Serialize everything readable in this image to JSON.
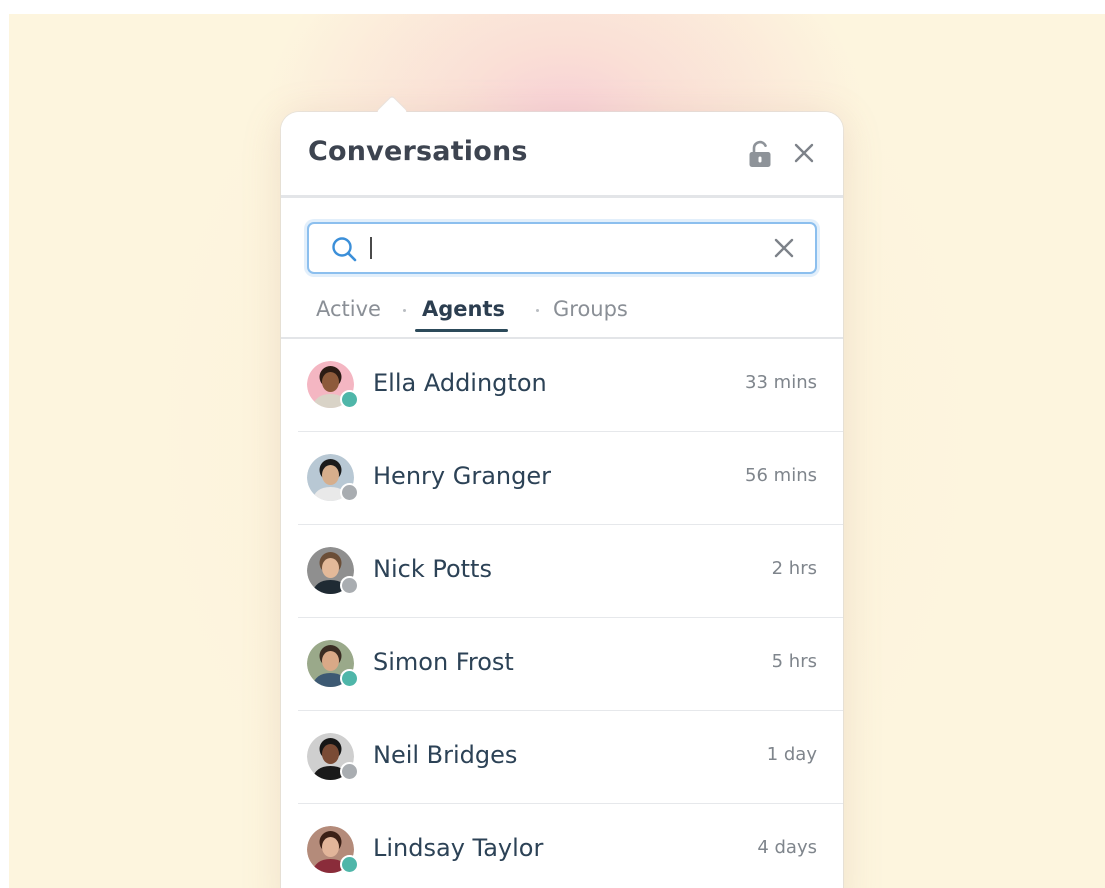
{
  "panel": {
    "title": "Conversations",
    "lock_icon": "unlock-icon",
    "close_icon": "close-icon"
  },
  "search": {
    "value": "",
    "placeholder": "",
    "icon": "search-icon",
    "clear_icon": "clear-icon"
  },
  "tabs": [
    {
      "label": "Active",
      "active": false
    },
    {
      "label": "Agents",
      "active": true
    },
    {
      "label": "Groups",
      "active": false
    }
  ],
  "contacts": [
    {
      "name": "Ella Addington",
      "time": "33 mins",
      "status": "online",
      "avatar_bg": "#f4b6c2",
      "hair": "#2b1b14",
      "skin": "#8d5a3b",
      "shirt": "#d9d3c7"
    },
    {
      "name": "Henry Granger",
      "time": "56 mins",
      "status": "offline",
      "avatar_bg": "#b8c8d4",
      "hair": "#1b1b1b",
      "skin": "#d6ae8c",
      "shirt": "#e9e9e9"
    },
    {
      "name": "Nick Potts",
      "time": "2 hrs",
      "status": "offline",
      "avatar_bg": "#8f8f8f",
      "hair": "#6b4e37",
      "skin": "#e3b999",
      "shirt": "#1f2a33"
    },
    {
      "name": "Simon Frost",
      "time": "5 hrs",
      "status": "online",
      "avatar_bg": "#9aa98a",
      "hair": "#3a2c22",
      "skin": "#d9a987",
      "shirt": "#3d5a73"
    },
    {
      "name": "Neil Bridges",
      "time": "1 day",
      "status": "offline",
      "avatar_bg": "#cfcfcf",
      "hair": "#161616",
      "skin": "#7a4b35",
      "shirt": "#1a1a1a"
    },
    {
      "name": "Lindsay Taylor",
      "time": "4 days",
      "status": "online",
      "avatar_bg": "#b48b7a",
      "hair": "#3b2016",
      "skin": "#e2b59a",
      "shirt": "#8a2c3a"
    }
  ],
  "colors": {
    "online": "#4fb6a9",
    "offline": "#a9adb1",
    "accent": "#2c4a5a",
    "search_border": "#8cbfee"
  }
}
